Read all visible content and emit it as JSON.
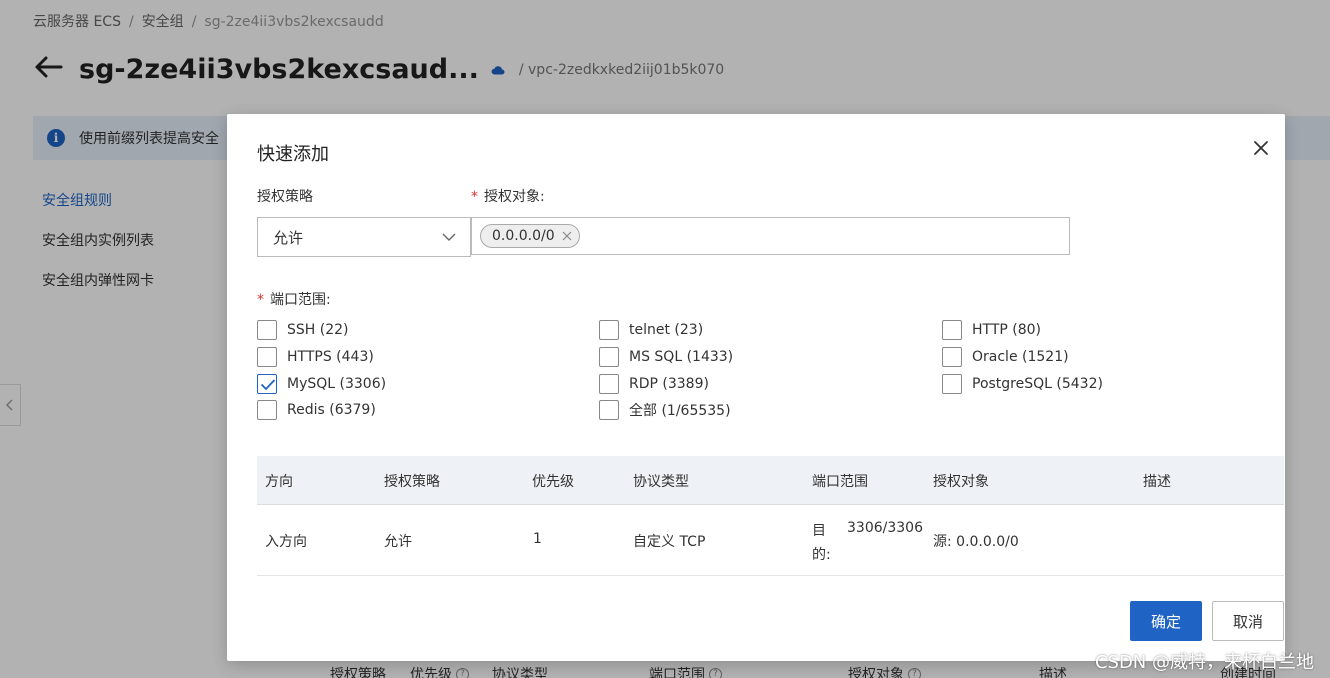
{
  "breadcrumb": {
    "items": [
      "云服务器 ECS",
      "安全组",
      "sg-2ze4ii3vbs2kexcsaudd"
    ],
    "separator": "/"
  },
  "header": {
    "title": "sg-2ze4ii3vbs2kexcsaud...",
    "vpc": "/ vpc-2zedkxked2iij01b5k070"
  },
  "info_bar": {
    "text": "使用前缀列表提高安全"
  },
  "side_nav": {
    "items": [
      {
        "label": "安全组规则",
        "active": true
      },
      {
        "label": "安全组内实例列表",
        "active": false
      },
      {
        "label": "安全组内弹性网卡",
        "active": false
      }
    ]
  },
  "bg_table_header": {
    "cols": [
      "授权策略",
      "优先级",
      "协议类型",
      "端口范围",
      "授权对象",
      "描述",
      "创建时间"
    ]
  },
  "modal": {
    "title": "快速添加",
    "policy_label": "授权策略",
    "policy_value": "允许",
    "target_label": "授权对象:",
    "target_tags": [
      "0.0.0.0/0"
    ],
    "port_label": "端口范围:",
    "ports": [
      {
        "label": "SSH (22)",
        "checked": false
      },
      {
        "label": "telnet (23)",
        "checked": false
      },
      {
        "label": "HTTP (80)",
        "checked": false
      },
      {
        "label": "HTTPS (443)",
        "checked": false
      },
      {
        "label": "MS SQL (1433)",
        "checked": false
      },
      {
        "label": "Oracle (1521)",
        "checked": false
      },
      {
        "label": "MySQL (3306)",
        "checked": true
      },
      {
        "label": "RDP (3389)",
        "checked": false
      },
      {
        "label": "PostgreSQL (5432)",
        "checked": false
      },
      {
        "label": "Redis (6379)",
        "checked": false
      },
      {
        "label": "全部 (1/65535)",
        "checked": false
      }
    ],
    "table": {
      "headers": [
        "方向",
        "授权策略",
        "优先级",
        "协议类型",
        "端口范围",
        "授权对象",
        "描述"
      ],
      "rows": [
        {
          "direction": "入方向",
          "policy": "允许",
          "priority": "1",
          "protocol": "自定义 TCP",
          "port_prefix_1": "目",
          "port_prefix_2": "的:",
          "port_value": "3306/3306",
          "target": "源: 0.0.0.0/0",
          "description": ""
        }
      ]
    },
    "ok_label": "确定",
    "cancel_label": "取消"
  },
  "watermark": "CSDN @威特，来杯白兰地",
  "colors": {
    "primary": "#1f64c4",
    "required": "#d92f2f",
    "info_bg": "#e6f0fb"
  }
}
